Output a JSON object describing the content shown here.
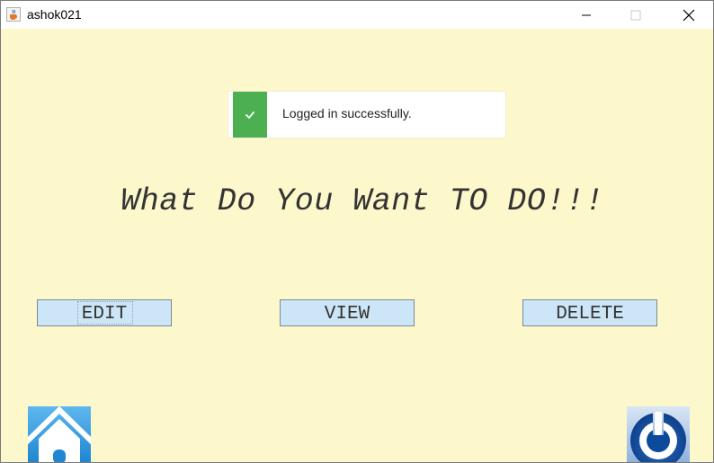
{
  "window": {
    "title": "ashok021",
    "app_icon": "java-cup-icon",
    "controls": [
      "minimize-icon",
      "maximize-icon",
      "close-icon"
    ]
  },
  "toast": {
    "message": "Logged in successfully.",
    "icon": "check-icon",
    "color": "#4caf50"
  },
  "main": {
    "headline": "What Do You Want TO DO!!!",
    "buttons": {
      "edit": "EDIT",
      "view": "VIEW",
      "delete": "DELETE"
    },
    "home_icon": "home-icon",
    "power_icon": "power-icon"
  },
  "colors": {
    "background": "#fdf7cc",
    "button_fill": "#cde6f7",
    "success": "#4caf50",
    "icon_blue": "#0a4b9a"
  }
}
